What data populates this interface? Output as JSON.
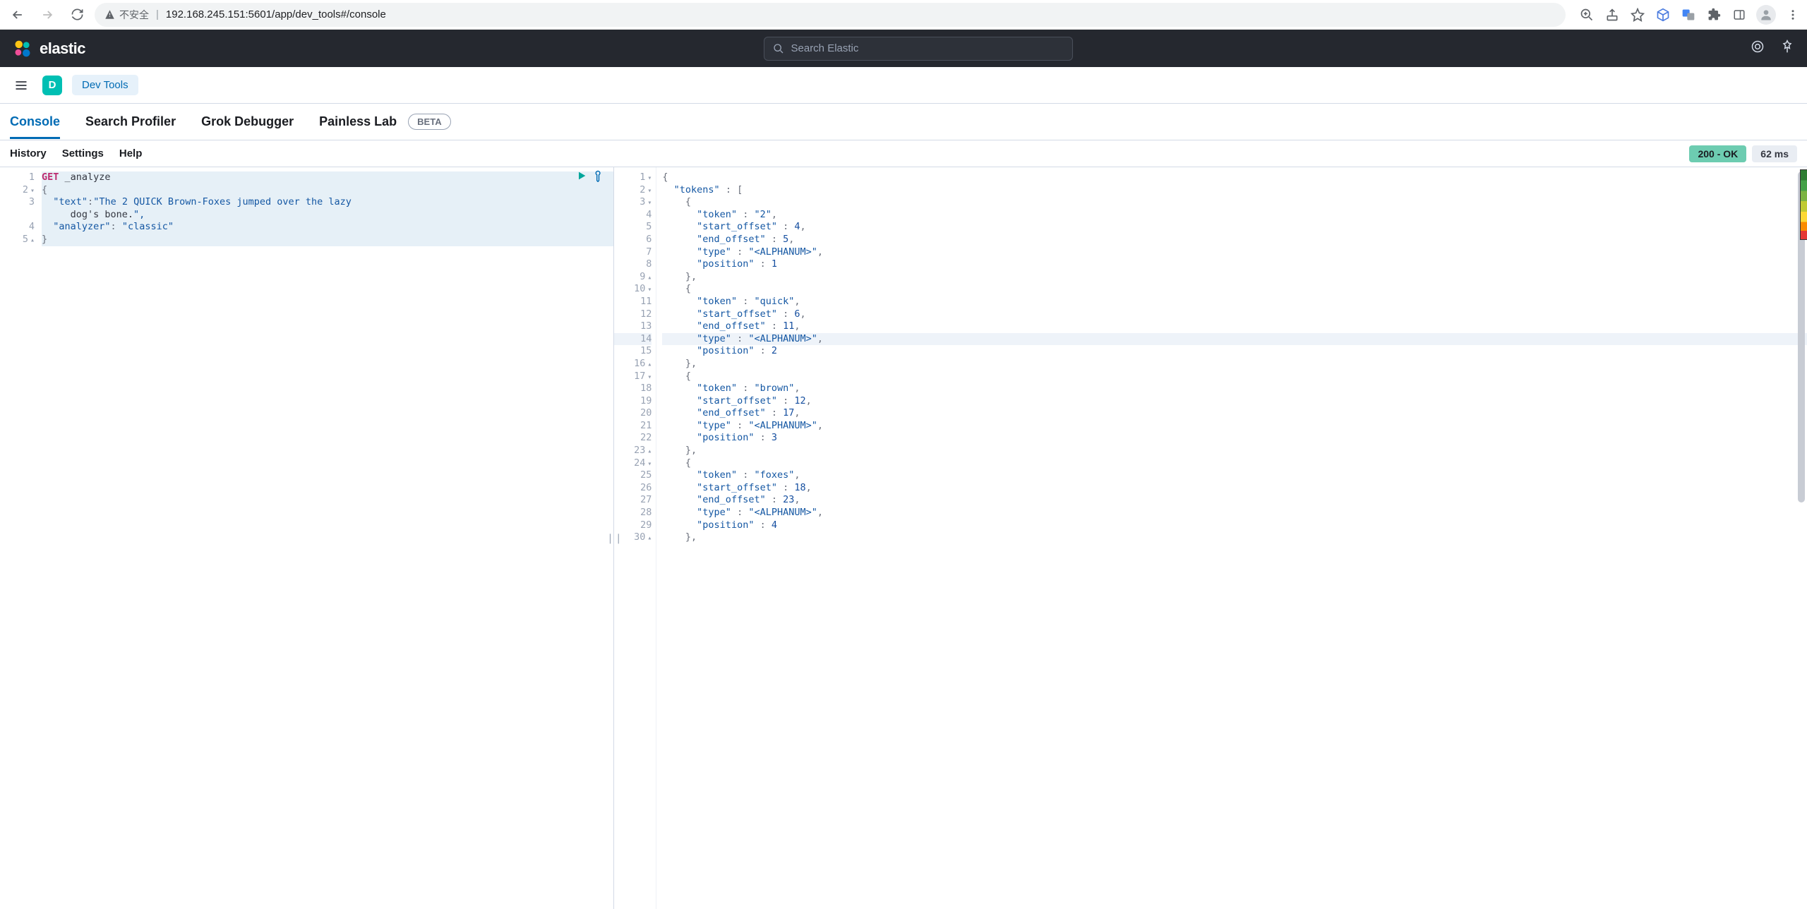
{
  "chrome": {
    "insecure_label": "不安全",
    "url": "192.168.245.151:5601/app/dev_tools#/console"
  },
  "kibana": {
    "brand": "elastic",
    "search_placeholder": "Search Elastic"
  },
  "subheader": {
    "space_letter": "D",
    "breadcrumb": "Dev Tools"
  },
  "tabs": {
    "items": [
      "Console",
      "Search Profiler",
      "Grok Debugger",
      "Painless Lab"
    ],
    "beta": "BETA"
  },
  "toolbar": {
    "history": "History",
    "settings": "Settings",
    "help": "Help",
    "status": "200 - OK",
    "time": "62 ms"
  },
  "request": {
    "method": "GET",
    "path": "_analyze",
    "body_lines": [
      "{",
      "  \"text\":\"The 2 QUICK Brown-Foxes jumped over the lazy",
      "     dog's bone.\",",
      "  \"analyzer\": \"classic\"",
      "}"
    ],
    "gutter": [
      "1",
      "2",
      "3",
      "",
      "4",
      "5"
    ],
    "fold_lines": [
      2,
      5
    ]
  },
  "response": {
    "gutter_start": 1,
    "gutter_end": 30,
    "fold_down_lines": [
      1,
      2,
      3,
      10,
      17,
      24
    ],
    "fold_up_lines": [
      9,
      16,
      23,
      30
    ],
    "highlighted_line": 14,
    "lines": [
      "{",
      "  \"tokens\" : [",
      "    {",
      "      \"token\" : \"2\",",
      "      \"start_offset\" : 4,",
      "      \"end_offset\" : 5,",
      "      \"type\" : \"<ALPHANUM>\",",
      "      \"position\" : 1",
      "    },",
      "    {",
      "      \"token\" : \"quick\",",
      "      \"start_offset\" : 6,",
      "      \"end_offset\" : 11,",
      "      \"type\" : \"<ALPHANUM>\",",
      "      \"position\" : 2",
      "    },",
      "    {",
      "      \"token\" : \"brown\",",
      "      \"start_offset\" : 12,",
      "      \"end_offset\" : 17,",
      "      \"type\" : \"<ALPHANUM>\",",
      "      \"position\" : 3",
      "    },",
      "    {",
      "      \"token\" : \"foxes\",",
      "      \"start_offset\" : 18,",
      "      \"end_offset\" : 23,",
      "      \"type\" : \"<ALPHANUM>\",",
      "      \"position\" : 4",
      "    },"
    ]
  }
}
